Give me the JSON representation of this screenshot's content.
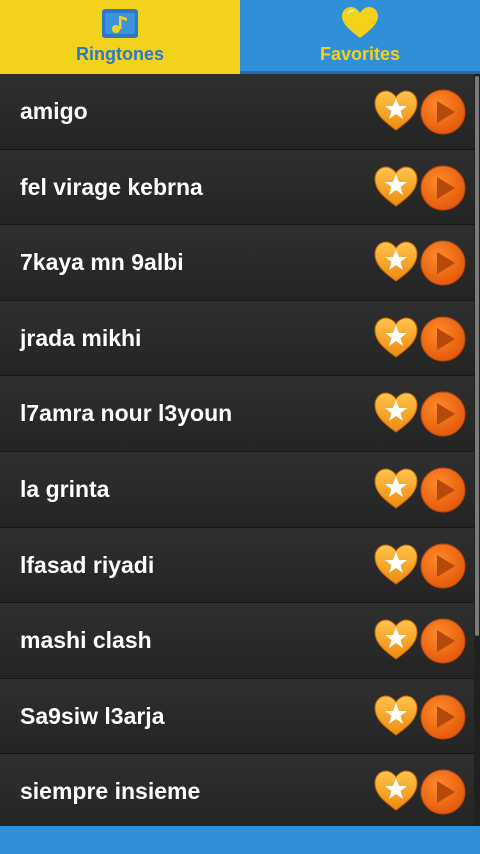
{
  "tabs": [
    {
      "label": "Ringtones",
      "icon": "folder-music-icon",
      "selected": true
    },
    {
      "label": "Favorites",
      "icon": "heart-icon",
      "selected": false
    }
  ],
  "ringtones": [
    "amigo",
    "fel virage kebrna",
    "7kaya mn 9albi",
    "jrada mikhi",
    "l7amra nour l3youn",
    "la grinta",
    "lfasad riyadi",
    "mashi clash",
    "Sa9siw l3arja",
    "siempre insieme"
  ],
  "row_icons": {
    "favorite": "heart-star-icon",
    "play": "play-icon"
  },
  "colors": {
    "tab_selected": "#f2d21d",
    "tab_unselected": "#2f8fd8",
    "accent_orange": "#f06a10",
    "heart_orange": "#f6a623"
  }
}
